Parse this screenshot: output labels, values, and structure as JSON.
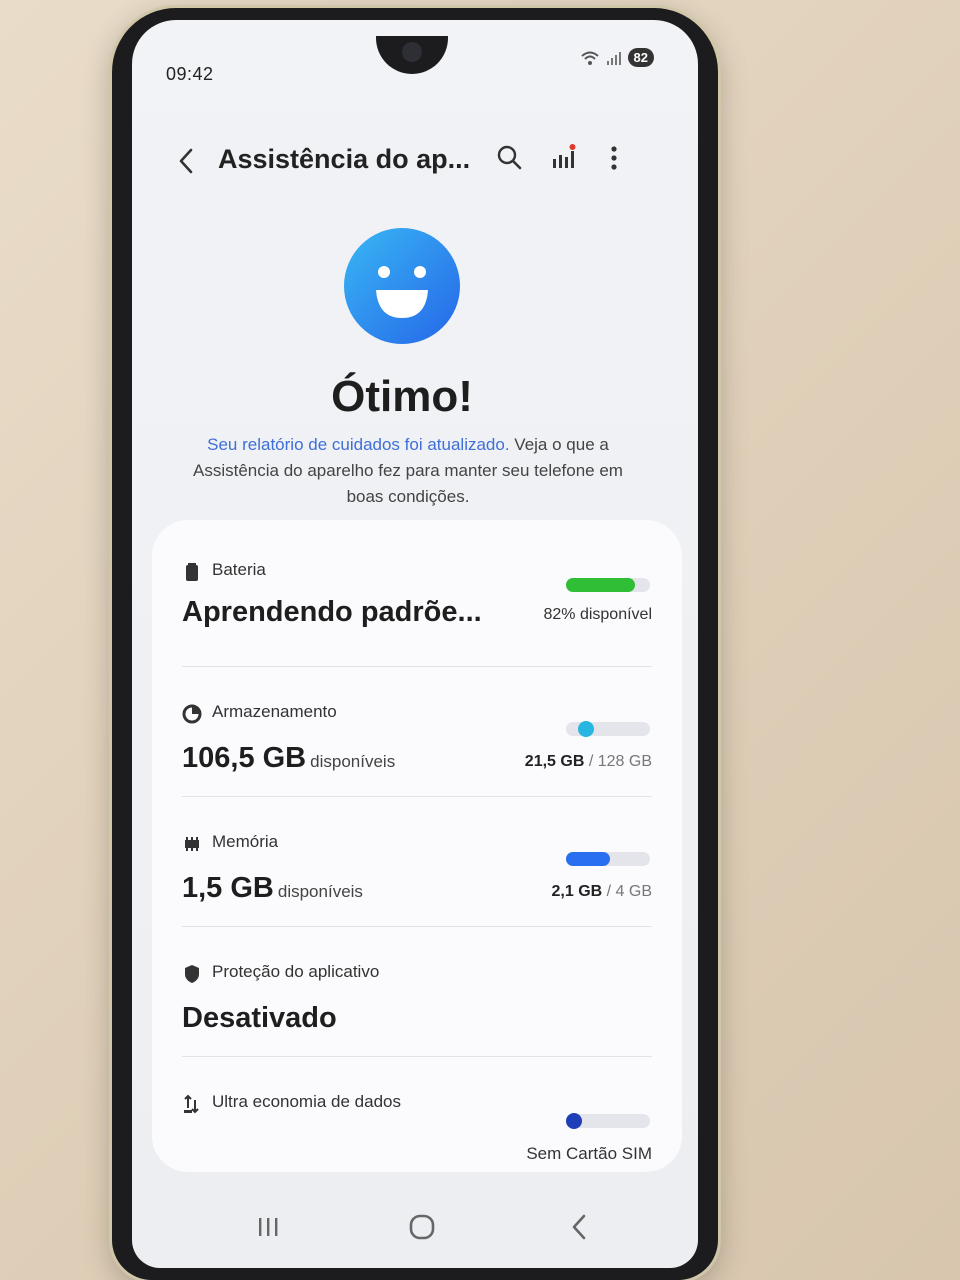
{
  "status_bar": {
    "time": "09:42",
    "battery": "82"
  },
  "app_bar": {
    "title": "Assistência do ap...",
    "back_icon": "chevron-left-icon",
    "search_icon": "search-icon",
    "stats_icon": "signal-bars-icon",
    "more_icon": "more-vertical-icon"
  },
  "hero": {
    "icon": "smiley-face-icon",
    "headline": "Ótimo!",
    "description_link": "Seu relatório de cuidados foi atualizado.",
    "description_rest": " Veja o que a Assistência do aparelho fez para manter seu telefone em boas condições."
  },
  "items": {
    "battery": {
      "label": "Bateria",
      "value": "Aprendendo padrõe...",
      "right_text": "82% disponível",
      "level": 0.82,
      "color": "#2fbe35"
    },
    "storage": {
      "label": "Armazenamento",
      "value": "106,5 GB",
      "value_unit": "disponíveis",
      "used": "21,5 GB",
      "total": "/ 128 GB",
      "level": 0.17,
      "color": "#29b6e0"
    },
    "memory": {
      "label": "Memória",
      "value": "1,5 GB",
      "value_unit": "disponíveis",
      "used": "2,1 GB",
      "total": "/ 4 GB",
      "level": 0.52,
      "color": "#2a6ff0"
    },
    "app_protection": {
      "label": "Proteção do aplicativo",
      "value": "Desativado"
    },
    "data_saver": {
      "label": "Ultra economia de dados",
      "right_text": "Sem Cartão SIM",
      "level": 0.0,
      "color": "#1e3fb8"
    }
  },
  "nav_bar": {
    "recents_icon": "recents-icon",
    "home_icon": "home-icon",
    "back_icon": "back-icon"
  }
}
